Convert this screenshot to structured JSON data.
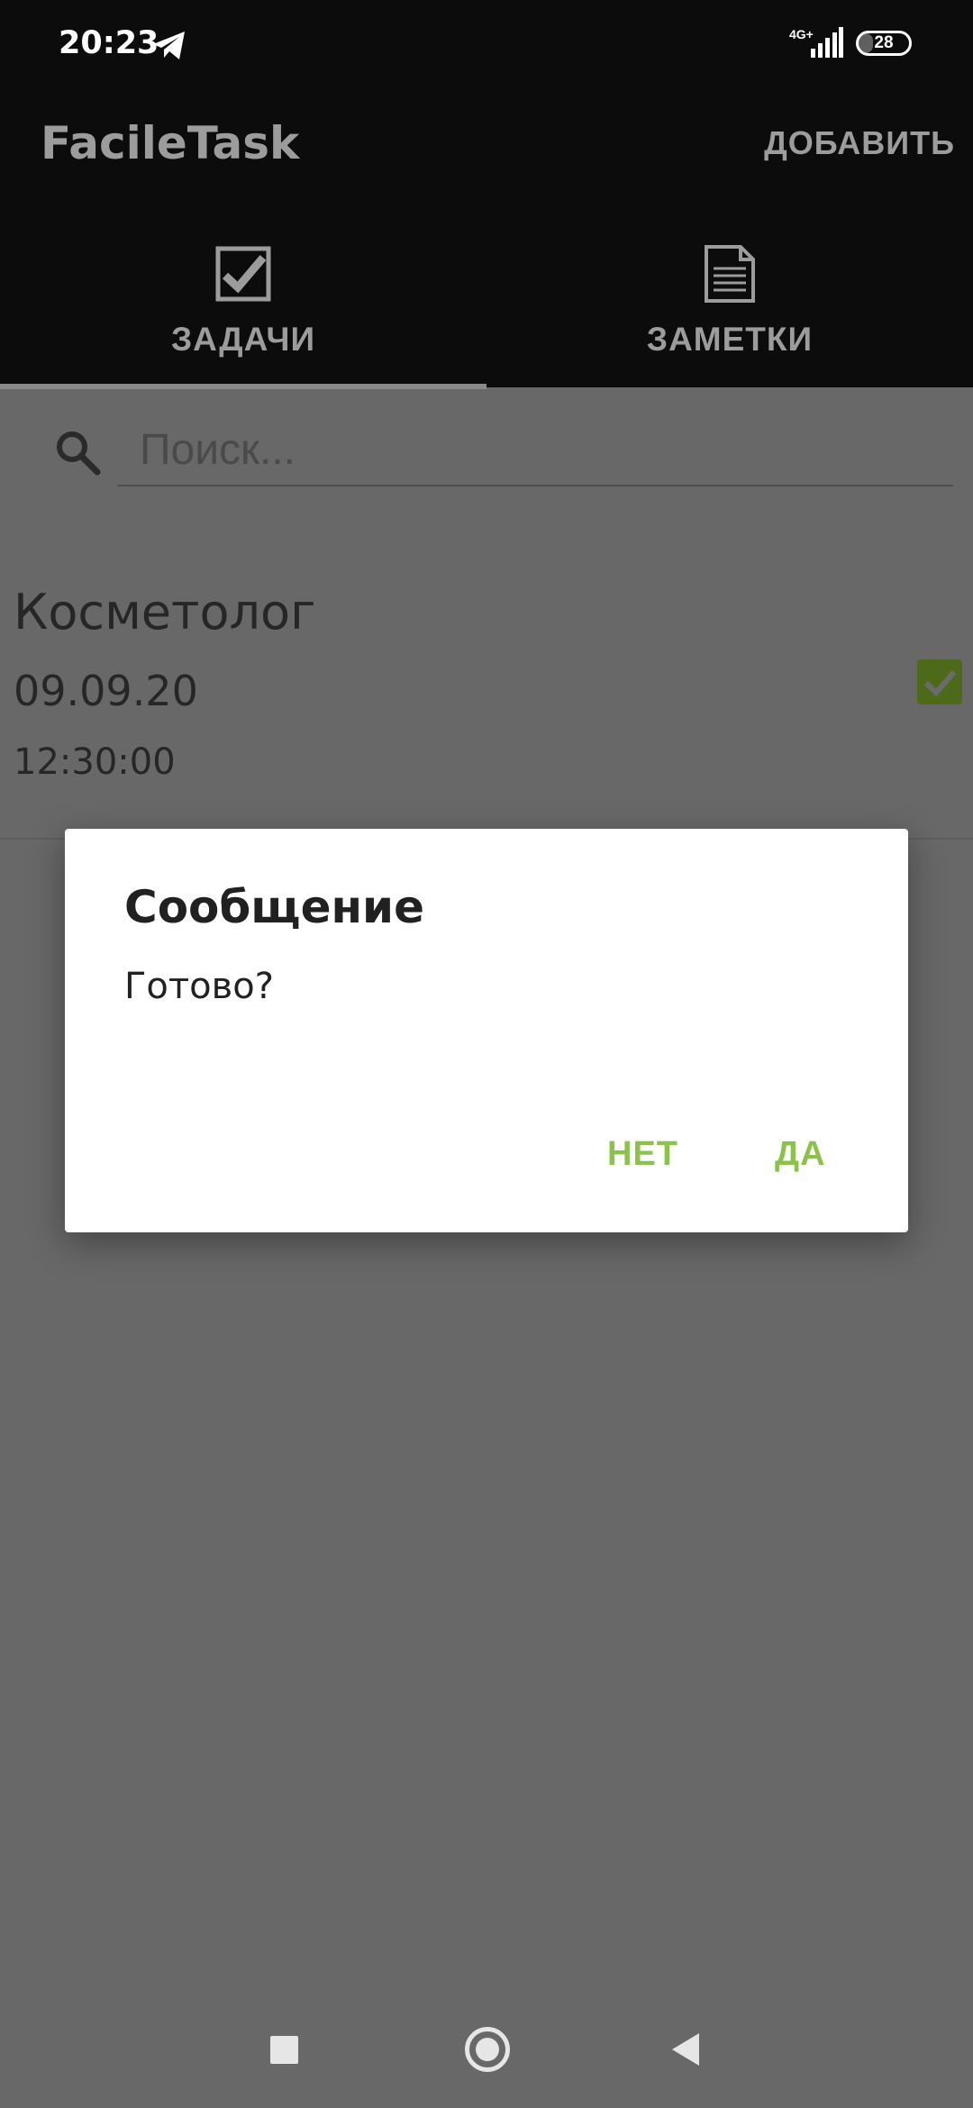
{
  "status_bar": {
    "time": "20:23",
    "network": "4G+",
    "battery": "28",
    "battery_level": 0.28
  },
  "app_bar": {
    "title": "FacileTask",
    "add_label": "ДОБАВИТЬ"
  },
  "tabs": [
    {
      "label": "ЗАДАЧИ",
      "icon": "checkbox-icon",
      "selected": true
    },
    {
      "label": "ЗАМЕТКИ",
      "icon": "document-icon",
      "selected": false
    }
  ],
  "search": {
    "placeholder": "Поиск...",
    "value": ""
  },
  "tasks": [
    {
      "title": "Косметолог",
      "date": "09.09.20",
      "time": "12:30:00",
      "done": true
    }
  ],
  "dialog": {
    "title": "Сообщение",
    "message": "Готово?",
    "negative_label": "НЕТ",
    "positive_label": "ДА"
  },
  "colors": {
    "accent": "#8bc34a",
    "app_bar_background": "#0c0c0c",
    "scrim_background": "#686868",
    "checkbox_fill": "#4d6a18"
  }
}
